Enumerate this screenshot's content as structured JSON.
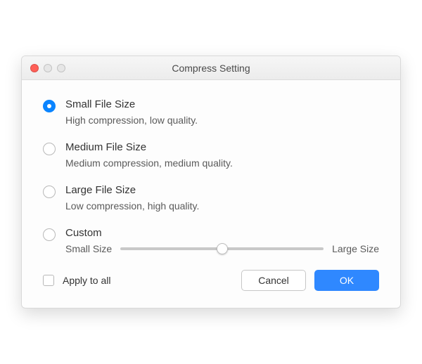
{
  "window": {
    "title": "Compress Setting"
  },
  "options": [
    {
      "title": "Small File Size",
      "desc": "High compression, low quality.",
      "selected": true
    },
    {
      "title": "Medium File Size",
      "desc": "Medium compression, medium quality.",
      "selected": false
    },
    {
      "title": "Large File Size",
      "desc": "Low compression, high quality.",
      "selected": false
    },
    {
      "title": "Custom",
      "selected": false
    }
  ],
  "slider": {
    "min_label": "Small Size",
    "max_label": "Large Size"
  },
  "apply_all": {
    "label": "Apply to all",
    "checked": false
  },
  "buttons": {
    "cancel": "Cancel",
    "ok": "OK"
  }
}
